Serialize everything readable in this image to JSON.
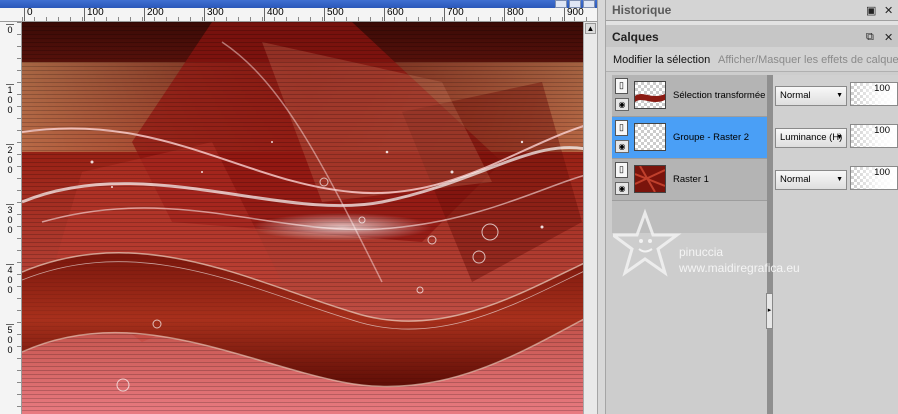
{
  "ruler_top": {
    "ticks": [
      "0",
      "100",
      "200",
      "300",
      "400",
      "500",
      "600",
      "700",
      "800",
      "900"
    ]
  },
  "ruler_left": {
    "ticks": [
      "0",
      "100",
      "200",
      "300",
      "400",
      "500"
    ]
  },
  "historique": {
    "title": "Historique",
    "close_icon": "x-icon",
    "menu_icon": "square-icon"
  },
  "calques": {
    "title": "Calques",
    "pin_icon": "dock-icon",
    "toolbar": {
      "modify_label": "Modifier la sélection",
      "toggle_label": "Afficher/Masquer les effets de calque"
    },
    "layers": [
      {
        "name": "Sélection transformée",
        "blend": "Normal",
        "opacity": "100",
        "selected": false
      },
      {
        "name": "Groupe - Raster 2",
        "blend": "Luminance (H)",
        "opacity": "100",
        "selected": true
      },
      {
        "name": "Raster 1",
        "blend": "Normal",
        "opacity": "100",
        "selected": false
      }
    ]
  },
  "watermark": {
    "name": "pinuccia",
    "site": "www.maidiregrafica.eu"
  },
  "colors": {
    "selection": "#4a9ff6",
    "canvas_red": "#8b0f0f"
  }
}
